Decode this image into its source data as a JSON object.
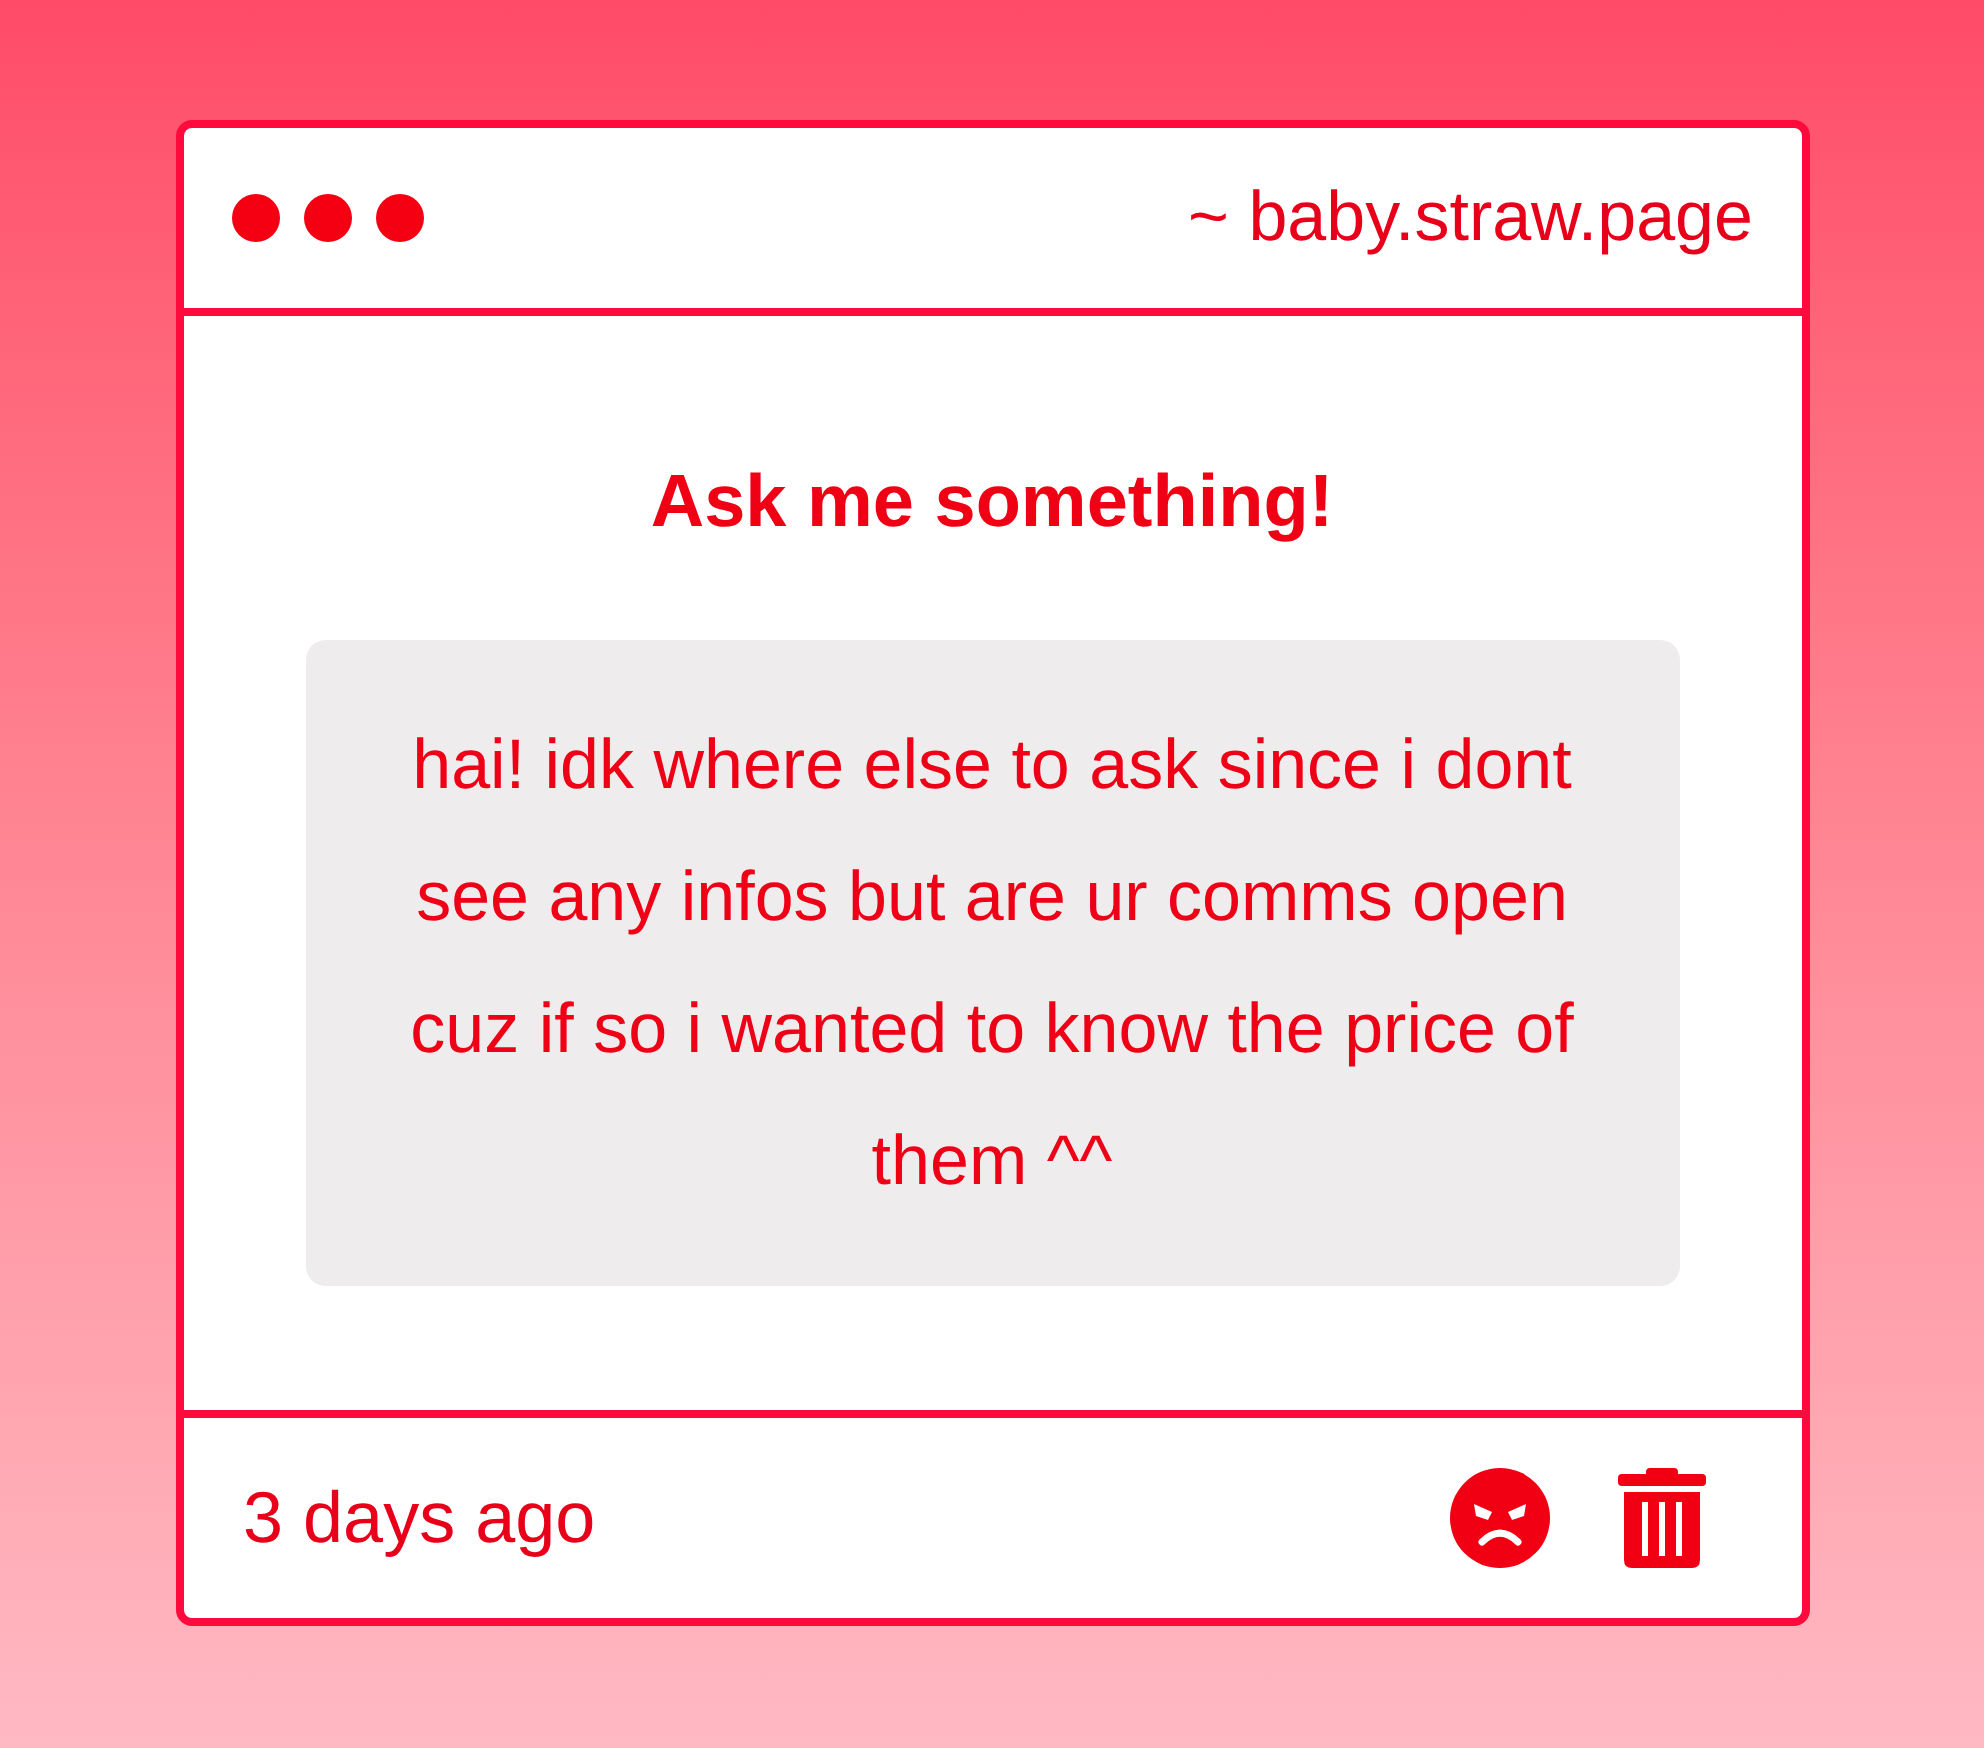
{
  "window": {
    "title": "~ baby.straw.page"
  },
  "heading": "Ask me something!",
  "question": "hai! idk where else to ask since i dont see any infos but are ur comms open cuz if so i wanted to know the price of them ^^",
  "footer": {
    "time": "3 days ago"
  }
}
